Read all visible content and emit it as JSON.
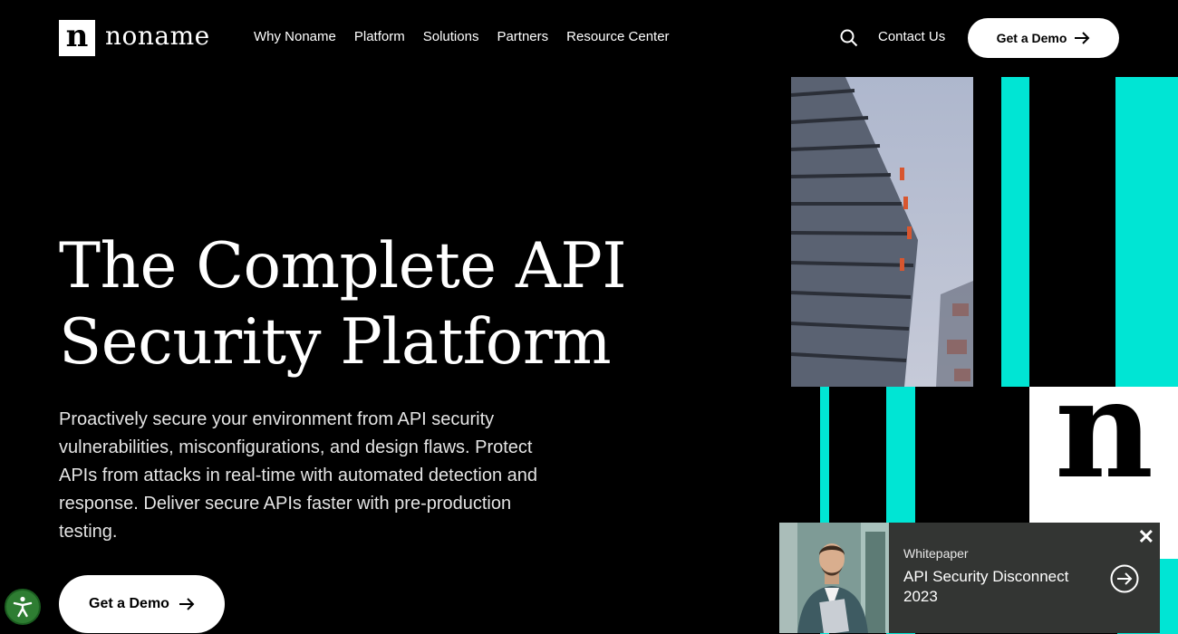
{
  "brand": {
    "logo_letter": "n",
    "name": "noname"
  },
  "nav": [
    {
      "label": "Why Noname"
    },
    {
      "label": "Platform"
    },
    {
      "label": "Solutions"
    },
    {
      "label": "Partners"
    },
    {
      "label": "Resource Center"
    }
  ],
  "header": {
    "contact_label": "Contact Us",
    "demo_label": "Get a Demo"
  },
  "hero": {
    "title_line1": "The Complete API",
    "title_line2": "Security Platform",
    "description": "Proactively secure your environment from API security vulnerabilities, misconfigurations, and design flaws. Protect APIs from attacks in real-time with automated detection and response. Deliver secure APIs faster with pre-production testing.",
    "cta_label": "Get a Demo"
  },
  "graphic": {
    "logo_letter": "n"
  },
  "promo": {
    "type": "Whitepaper",
    "title": "API Security Disconnect 2023",
    "close": "✕"
  },
  "colors": {
    "accent": "#00e5d4",
    "background": "#000000",
    "button": "#ffffff"
  },
  "icons": [
    "search-icon",
    "arrow-right-icon",
    "accessibility-icon",
    "arrow-circle-icon",
    "close-icon"
  ]
}
